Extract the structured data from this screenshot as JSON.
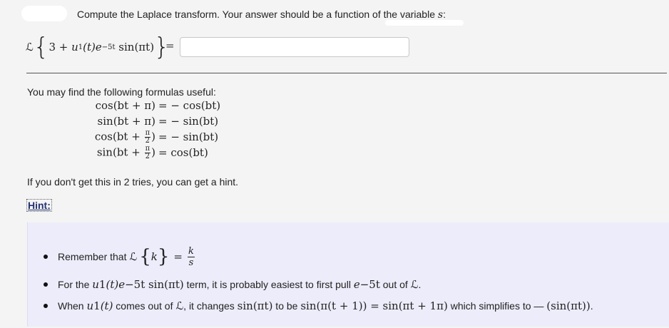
{
  "question": {
    "prompt": "Compute the Laplace transform. Your answer should be a function of the variable",
    "variable": "s",
    "colon": ":"
  },
  "equation": {
    "operator": "ℒ",
    "open_brace": "{",
    "expr_const": "3 + ",
    "u": "u",
    "u_sub": "1",
    "t_arg": "(t)e",
    "exp_sup": "−5t",
    "sin_part": " sin(πt)",
    "close_brace": "}",
    "equals": "=",
    "answer_value": "",
    "answer_placeholder": ""
  },
  "formulas": {
    "intro": "You may find the following formulas useful:",
    "rows": [
      {
        "lhs": "cos(bt + π)",
        "rhs": "= − cos(bt)"
      },
      {
        "lhs": "sin(bt + π)",
        "rhs": "= − sin(bt)"
      },
      {
        "lhs_pre": "cos(bt + ",
        "num": "π",
        "den": "2",
        "lhs_post": ")",
        "rhs": "= − sin(bt)"
      },
      {
        "lhs_pre": "sin(bt + ",
        "num": "π",
        "den": "2",
        "lhs_post": ")",
        "rhs": "= cos(bt)"
      }
    ]
  },
  "tries_text": "If you don't get this in 2 tries, you can get a hint.",
  "hint_label": "Hint:",
  "hints": {
    "h1_text": "Remember that ",
    "h1_L": "ℒ",
    "h1_k": "k",
    "h1_eq": "=",
    "h1_num": "k",
    "h1_den": "s",
    "h2_pre": "For the ",
    "h2_term": "u",
    "h2_sub": "1",
    "h2_term2": "(t)e",
    "h2_sup": "−5t",
    "h2_term3": " sin(πt)",
    "h2_mid": " term, it is probably easiest to first pull ",
    "h2_e": "e",
    "h2_e_sup": "−5t",
    "h2_post": " out of ",
    "h2_L": "ℒ",
    "h2_end": ".",
    "h3_pre": "When ",
    "h3_u": "u",
    "h3_sub": "1",
    "h3_t": "(t)",
    "h3_mid": " comes out of ",
    "h3_L": "ℒ",
    "h3_mid2": ", it changes ",
    "h3_expr1": "sin(πt)",
    "h3_mid3": " to be ",
    "h3_expr2": "sin(π(t + 1)) = sin(πt + 1π)",
    "h3_mid4": " which simplifies to — ",
    "h3_expr3": "(sin(πt))",
    "h3_end": "."
  }
}
